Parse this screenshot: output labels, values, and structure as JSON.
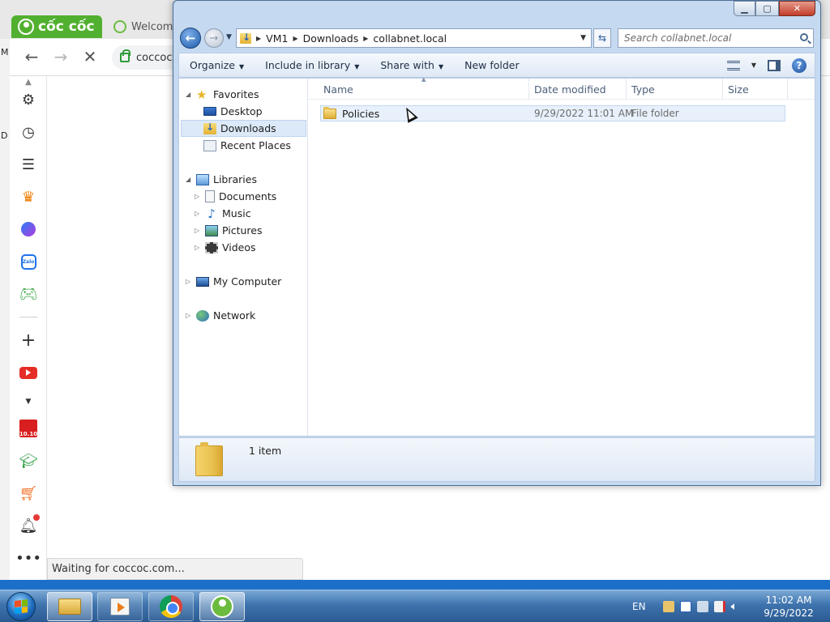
{
  "browser": {
    "brand_tab_label": "cốc cốc",
    "welcome_tab_label": "Welcome",
    "address_text": "coccoc",
    "status_text": "Waiting for coccoc.com...",
    "left_edge_letters": [
      "M",
      "D"
    ],
    "sidebar_icons": [
      "gear-icon",
      "history-icon",
      "list-icon",
      "crown-icon",
      "messenger-icon",
      "zalo-icon",
      "gamepad-icon",
      "plus-icon",
      "youtube-icon",
      "chevron-down-icon",
      "sale-1010-icon",
      "graduation-icon",
      "cart-icon",
      "bell-icon",
      "more-icon"
    ],
    "zalo_label": "Zalo",
    "sale_label": "10.10"
  },
  "explorer": {
    "path": [
      "VM1",
      "Downloads",
      "collabnet.local"
    ],
    "search_placeholder": "Search collabnet.local",
    "commands": {
      "organize": "Organize",
      "include_in_library": "Include in library",
      "share_with": "Share with",
      "new_folder": "New folder"
    },
    "nav_tree": {
      "favorites": "Favorites",
      "desktop": "Desktop",
      "downloads": "Downloads",
      "recent_places": "Recent Places",
      "libraries": "Libraries",
      "documents": "Documents",
      "music": "Music",
      "pictures": "Pictures",
      "videos": "Videos",
      "my_computer": "My Computer",
      "network": "Network"
    },
    "columns": {
      "name": "Name",
      "date_modified": "Date modified",
      "type": "Type",
      "size": "Size"
    },
    "files": [
      {
        "name": "Policies",
        "date_modified": "9/29/2022 11:01 AM",
        "type": "File folder",
        "size": ""
      }
    ],
    "details": {
      "item_count": "1 item"
    }
  },
  "taskbar": {
    "language": "EN",
    "time": "11:02 AM",
    "date": "9/29/2022"
  },
  "colors": {
    "coccoc_green": "#52b030",
    "win7_taskbar": "#3e73ad",
    "selection_blue": "#e8f1fb"
  }
}
